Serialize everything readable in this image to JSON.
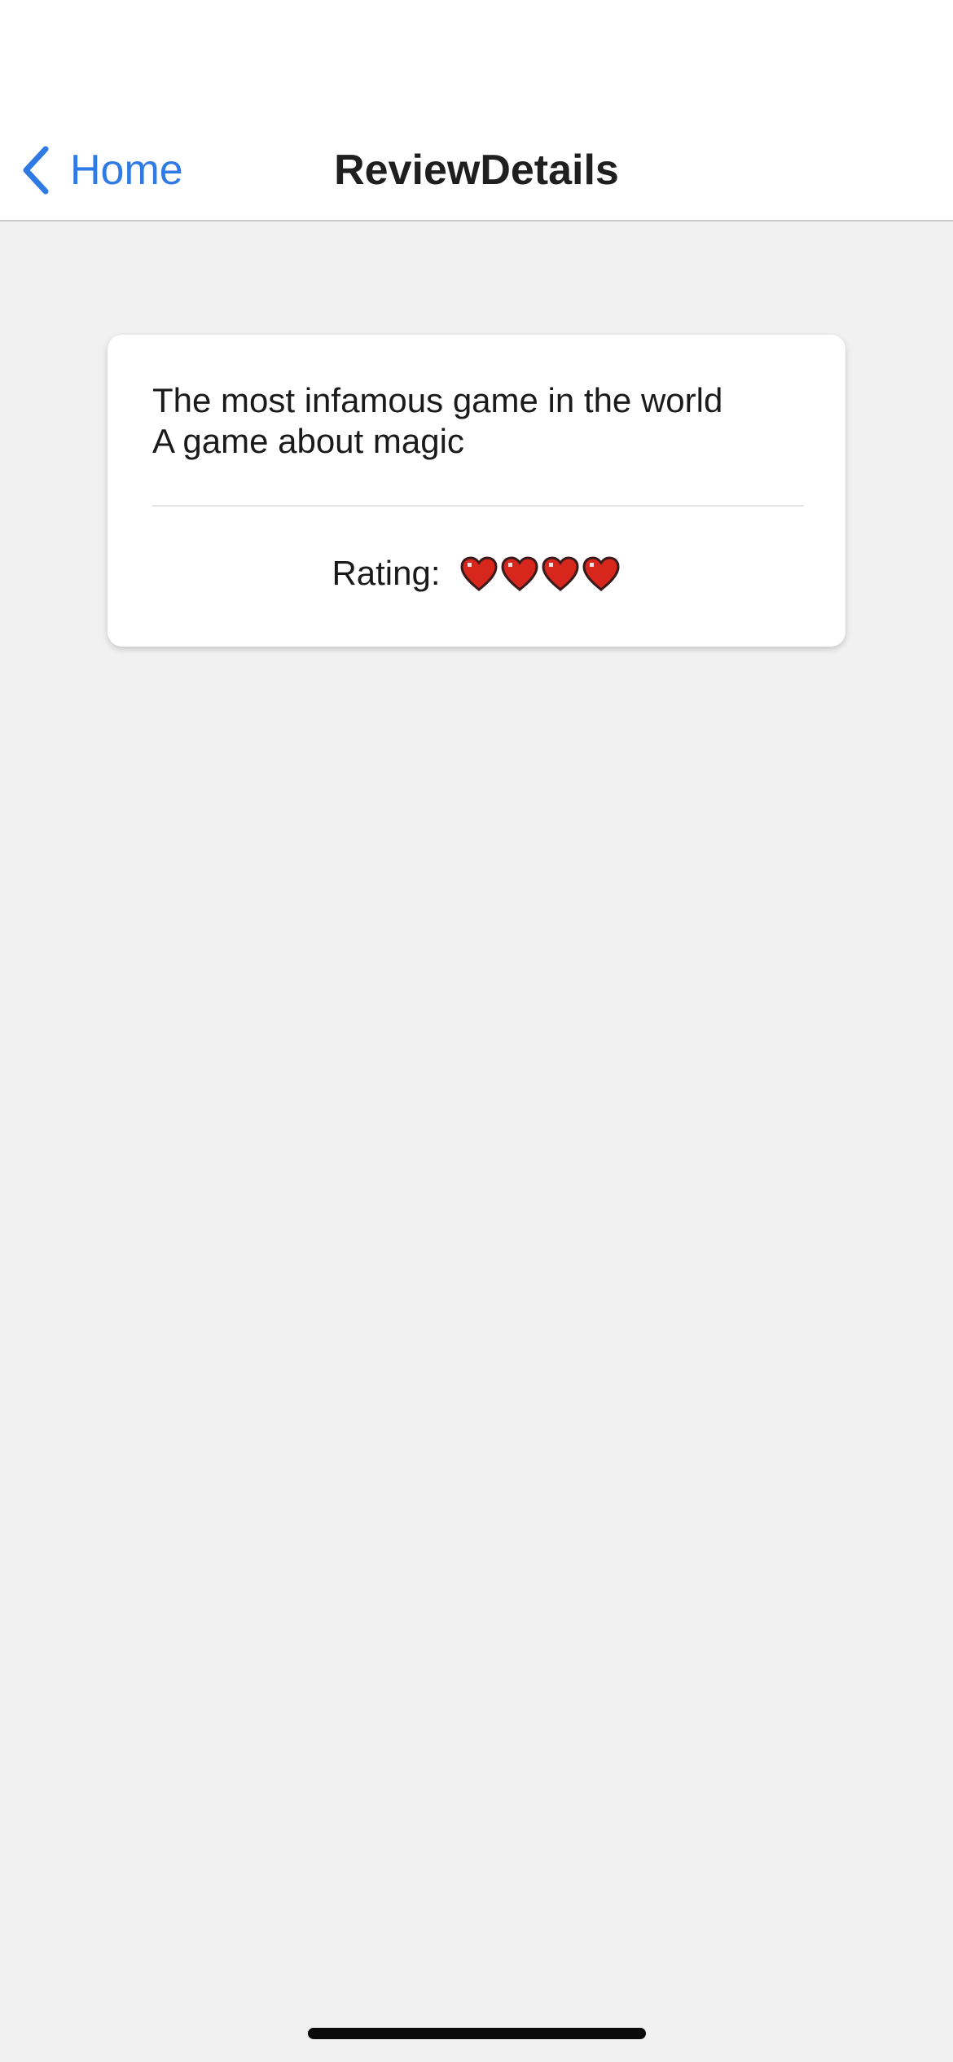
{
  "nav": {
    "back_label": "Home",
    "title": "ReviewDetails"
  },
  "review": {
    "title": "The most infamous game in the world",
    "body": "A game about magic",
    "rating_label": "Rating:",
    "rating_value": 4,
    "rating_icon": "heart-icon"
  },
  "colors": {
    "accent": "#2f7ae5",
    "background": "#f1f1f1",
    "card": "#ffffff",
    "heart": "#d7261c"
  }
}
